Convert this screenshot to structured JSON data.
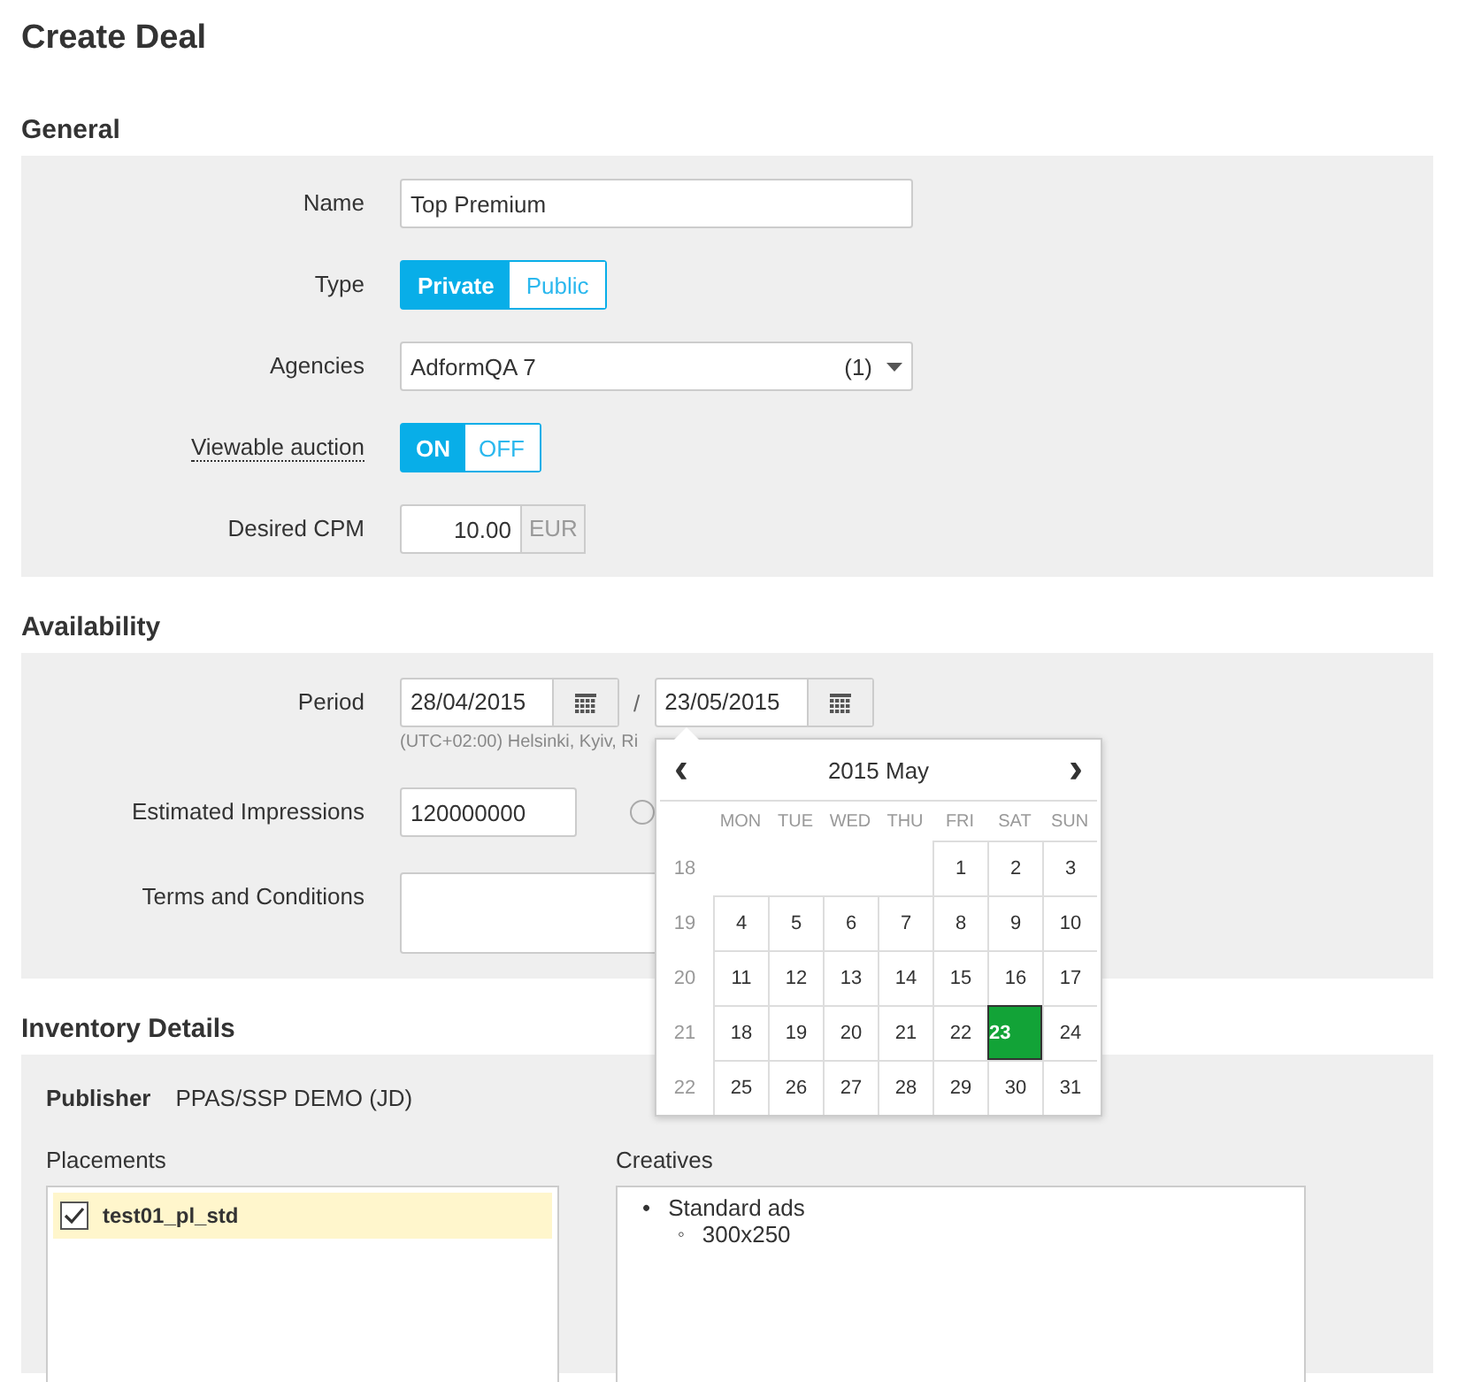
{
  "page_title": "Create Deal",
  "general": {
    "heading": "General",
    "name": {
      "label": "Name",
      "value": "Top Premium"
    },
    "type": {
      "label": "Type",
      "options": [
        {
          "label": "Private",
          "selected": true
        },
        {
          "label": "Public",
          "selected": false
        }
      ]
    },
    "agencies": {
      "label": "Agencies",
      "value": "AdformQA 7",
      "count": "(1)"
    },
    "viewable_auction": {
      "label": "Viewable auction",
      "options": [
        {
          "label": "ON",
          "selected": true
        },
        {
          "label": "OFF",
          "selected": false
        }
      ]
    },
    "desired_cpm": {
      "label": "Desired CPM",
      "value": "10.00",
      "currency": "EUR"
    }
  },
  "availability": {
    "heading": "Availability",
    "period": {
      "label": "Period",
      "start": "28/04/2015",
      "separator": "/",
      "end": "23/05/2015",
      "timezone": "(UTC+02:00) Helsinki, Kyiv, Ri"
    },
    "estimated_impressions": {
      "label": "Estimated Impressions",
      "value": "120000000",
      "option_selected": false
    },
    "terms": {
      "label": "Terms and Conditions"
    }
  },
  "calendar": {
    "title": "2015 May",
    "prev": "‹",
    "next": "›",
    "weekdays": [
      "MON",
      "TUE",
      "WED",
      "THU",
      "FRI",
      "SAT",
      "SUN"
    ],
    "weeks": [
      {
        "week": "18",
        "days": [
          {
            "label": "1",
            "selected": false
          },
          {
            "label": "2",
            "selected": false
          },
          {
            "label": "3",
            "selected": false
          }
        ]
      },
      {
        "week": "19",
        "days": [
          {
            "label": "4",
            "selected": false
          },
          {
            "label": "5",
            "selected": false
          },
          {
            "label": "6",
            "selected": false
          },
          {
            "label": "7",
            "selected": false
          },
          {
            "label": "8",
            "selected": false
          },
          {
            "label": "9",
            "selected": false
          },
          {
            "label": "10",
            "selected": false
          }
        ]
      },
      {
        "week": "20",
        "days": [
          {
            "label": "11",
            "selected": false
          },
          {
            "label": "12",
            "selected": false
          },
          {
            "label": "13",
            "selected": false
          },
          {
            "label": "14",
            "selected": false
          },
          {
            "label": "15",
            "selected": false
          },
          {
            "label": "16",
            "selected": false
          },
          {
            "label": "17",
            "selected": false
          }
        ]
      },
      {
        "week": "21",
        "days": [
          {
            "label": "18",
            "selected": false
          },
          {
            "label": "19",
            "selected": false
          },
          {
            "label": "20",
            "selected": false
          },
          {
            "label": "21",
            "selected": false
          },
          {
            "label": "22",
            "selected": false
          },
          {
            "label": "23",
            "selected": true
          },
          {
            "label": "24",
            "selected": false
          }
        ]
      },
      {
        "week": "22",
        "days": [
          {
            "label": "25",
            "selected": false
          },
          {
            "label": "26",
            "selected": false
          },
          {
            "label": "27",
            "selected": false
          },
          {
            "label": "28",
            "selected": false
          },
          {
            "label": "29",
            "selected": false
          },
          {
            "label": "30",
            "selected": false
          },
          {
            "label": "31",
            "selected": false
          }
        ]
      }
    ]
  },
  "inventory": {
    "heading": "Inventory Details",
    "publisher": {
      "label": "Publisher",
      "value": "PPAS/SSP DEMO (JD)"
    },
    "placements": {
      "label": "Placements",
      "items": [
        {
          "label": "test01_pl_std",
          "checked": true,
          "selected": true
        }
      ]
    },
    "creatives": {
      "label": "Creatives",
      "items": [
        {
          "marker": "•",
          "label": "Standard ads",
          "children": [
            {
              "marker": "◦",
              "label": "300x250"
            }
          ]
        }
      ]
    }
  }
}
